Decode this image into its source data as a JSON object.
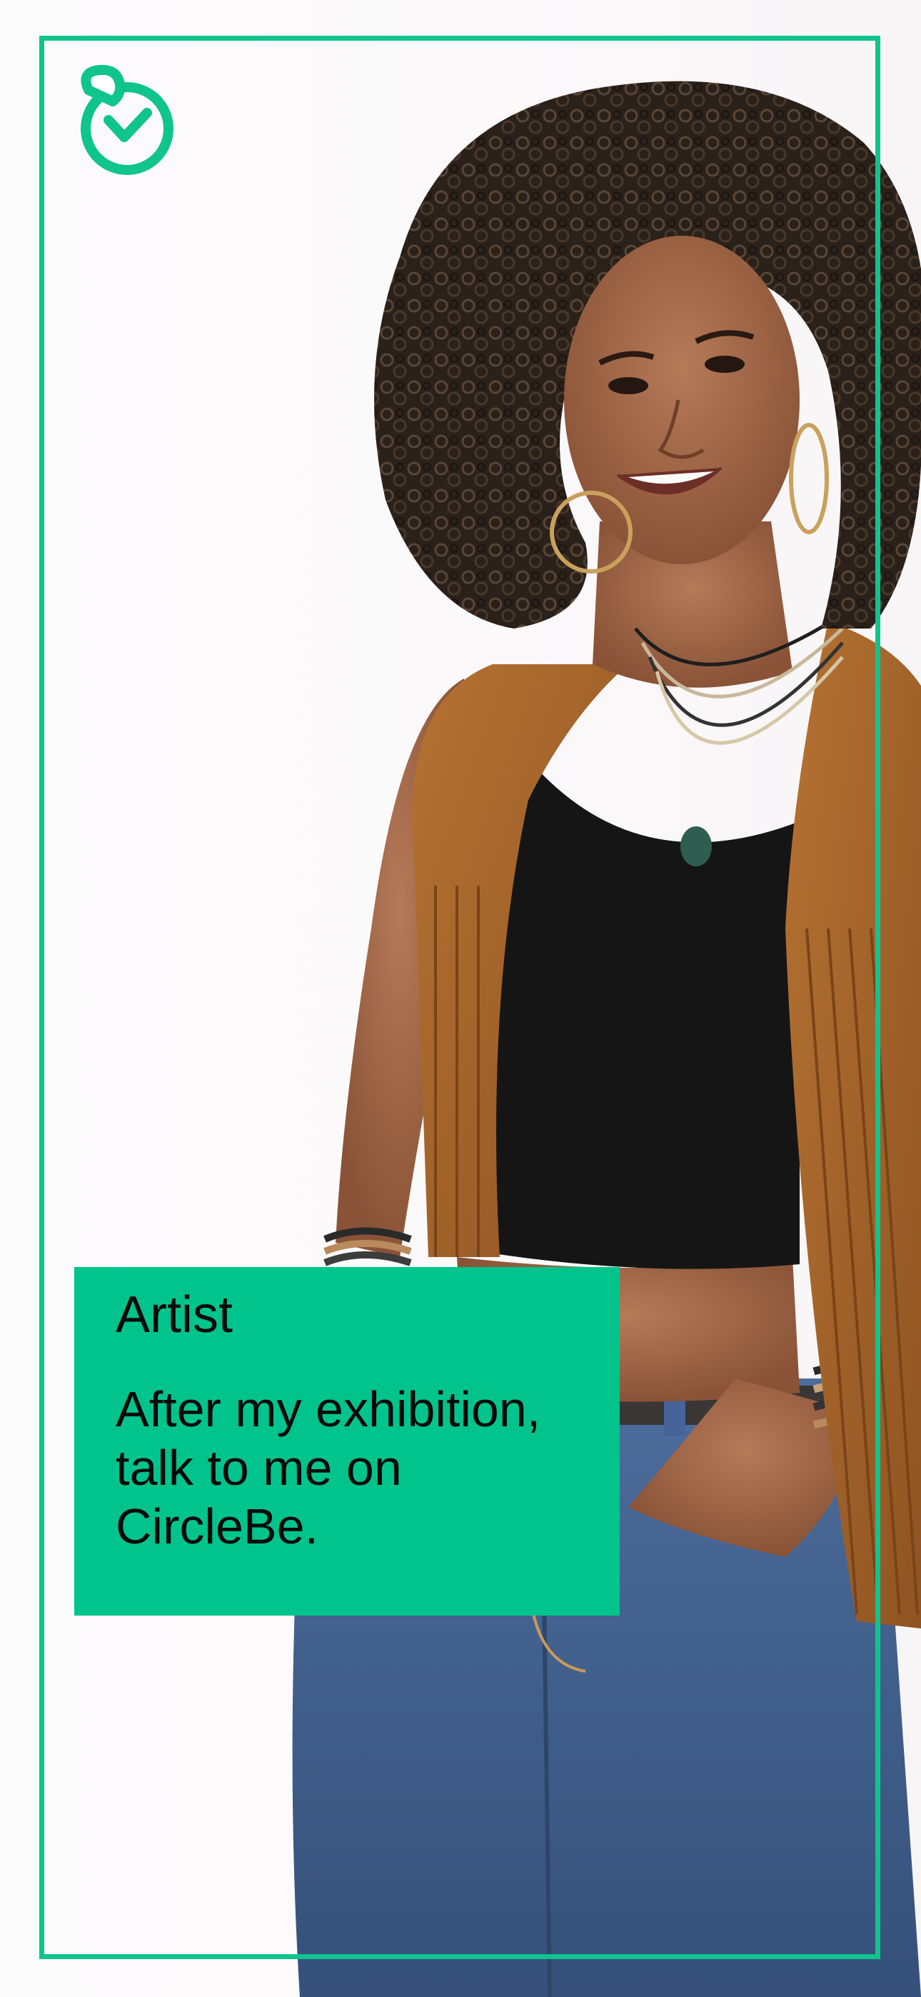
{
  "brand": {
    "name": "CircleBe",
    "logo_icon": "circlebe-logo-icon",
    "accent_color": "#00c48c",
    "frame_color": "#0fc48d"
  },
  "card": {
    "role": "Artist",
    "message": "After my exhibition, talk to me on CircleBe."
  },
  "photo": {
    "subject": "woman-portrait-image"
  }
}
